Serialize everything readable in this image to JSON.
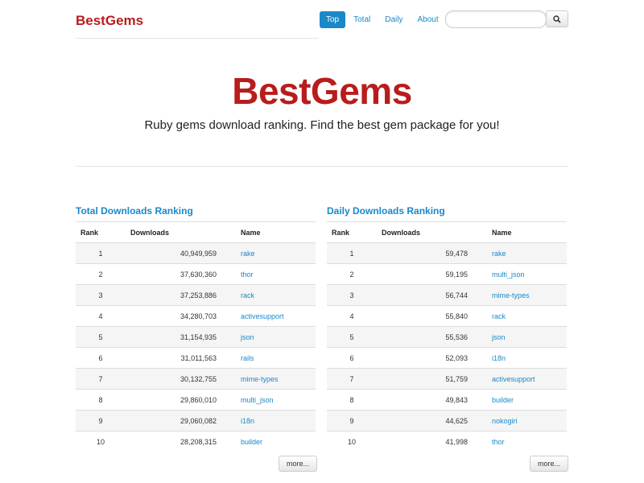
{
  "header": {
    "brand": "BestGems",
    "nav": [
      "Top",
      "Total",
      "Daily",
      "About"
    ],
    "search_placeholder": ""
  },
  "hero": {
    "title": "BestGems",
    "subtitle": "Ruby gems download ranking. Find the best gem package for you!"
  },
  "total": {
    "title": "Total Downloads Ranking",
    "columns": [
      "Rank",
      "Downloads",
      "Name"
    ],
    "rows": [
      [
        "1",
        "40,949,959",
        "rake"
      ],
      [
        "2",
        "37,630,360",
        "thor"
      ],
      [
        "3",
        "37,253,886",
        "rack"
      ],
      [
        "4",
        "34,280,703",
        "activesupport"
      ],
      [
        "5",
        "31,154,935",
        "json"
      ],
      [
        "6",
        "31,011,563",
        "rails"
      ],
      [
        "7",
        "30,132,755",
        "mime-types"
      ],
      [
        "8",
        "29,860,010",
        "multi_json"
      ],
      [
        "9",
        "29,060,082",
        "i18n"
      ],
      [
        "10",
        "28,208,315",
        "builder"
      ]
    ],
    "more_label": "more..."
  },
  "daily": {
    "title": "Daily Downloads Ranking",
    "columns": [
      "Rank",
      "Downloads",
      "Name"
    ],
    "rows": [
      [
        "1",
        "59,478",
        "rake"
      ],
      [
        "2",
        "59,195",
        "multi_json"
      ],
      [
        "3",
        "56,744",
        "mime-types"
      ],
      [
        "4",
        "55,840",
        "rack"
      ],
      [
        "5",
        "55,536",
        "json"
      ],
      [
        "6",
        "52,093",
        "i18n"
      ],
      [
        "7",
        "51,759",
        "activesupport"
      ],
      [
        "8",
        "49,843",
        "builder"
      ],
      [
        "9",
        "44,625",
        "nokogiri"
      ],
      [
        "10",
        "41,998",
        "thor"
      ]
    ],
    "more_label": "more..."
  },
  "colors": {
    "brand": "#b91c1c",
    "link": "#1b88c9"
  },
  "icons": {
    "search_button": "search-icon"
  }
}
